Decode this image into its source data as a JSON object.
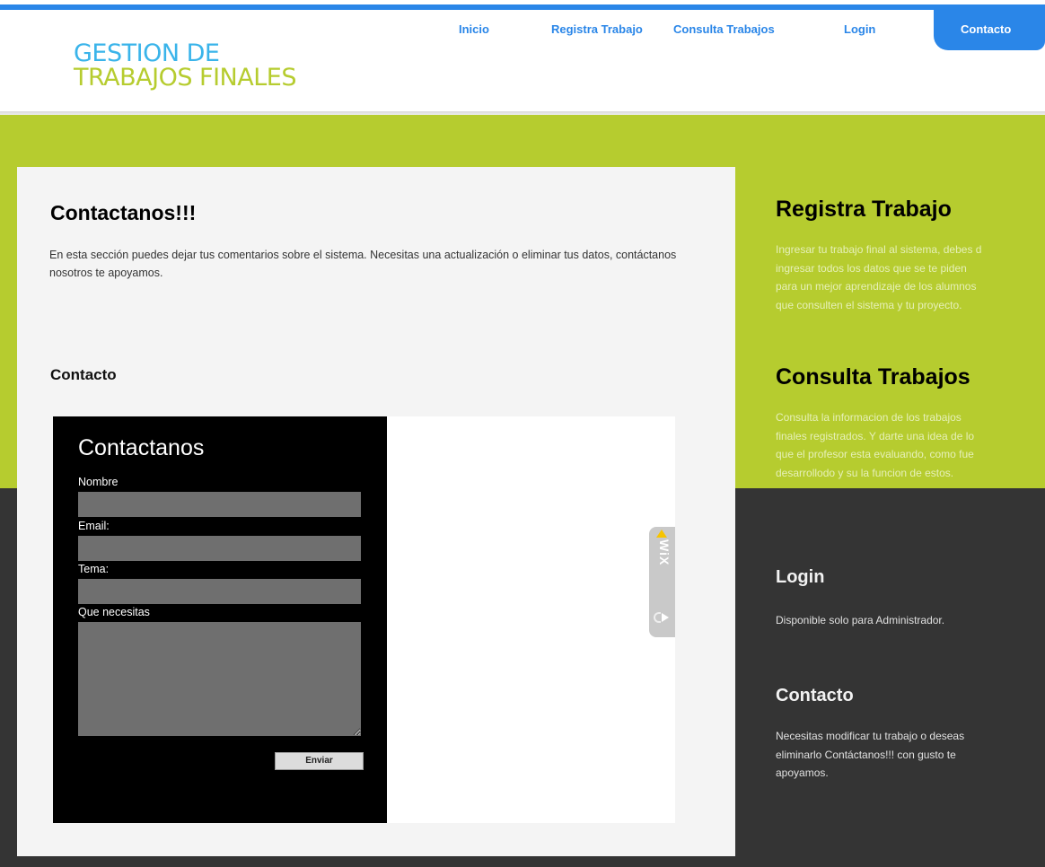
{
  "site": {
    "logo_line1": "GESTION DE",
    "logo_line2": "TRABAJOS FINALES"
  },
  "nav": {
    "items": [
      "Inicio",
      "Registra Trabajo",
      "Consulta Trabajos",
      "Login"
    ],
    "active": "Contacto"
  },
  "main": {
    "title": "Contactanos!!!",
    "intro": "En esta sección puedes dejar tus comentarios sobre el sistema. Necesitas una actualización o eliminar tus datos, contáctanos nosotros te apoyamos.",
    "section_title": "Contacto",
    "form": {
      "title": "Contactanos",
      "name_label": "Nombre",
      "name_value": "",
      "email_label": "Email:",
      "email_value": "",
      "topic_label": "Tema:",
      "topic_value": "",
      "message_label": "Que necesitas",
      "message_value": "",
      "submit_label": "Enviar"
    },
    "badge": "WiX"
  },
  "sidebar": {
    "blocks": [
      {
        "title": "Registra Trabajo",
        "text": "Ingresar tu trabajo final al sistema, debes d\ningresar todos los datos que se te piden\npara un mejor aprendizaje de los alumnos\nque consulten el sistema y tu proyecto."
      },
      {
        "title": "Consulta Trabajos",
        "text": "Consulta la informacion de los trabajos\nfinales registrados. Y darte una idea de lo\nque el profesor esta evaluando, como fue\ndesarrollodo y su la funcion de estos."
      },
      {
        "title": "Login",
        "text": "Disponible solo para Administrador."
      },
      {
        "title": "Contacto",
        "text": "Necesitas modificar tu trabajo o deseas\neliminarlo Contáctanos!!! con gusto te\napoyamos."
      }
    ]
  },
  "colors": {
    "accent_blue": "#2a86e8",
    "logo_blue": "#3ab4ea",
    "lime": "#b6cc2f",
    "dark": "#343434"
  }
}
